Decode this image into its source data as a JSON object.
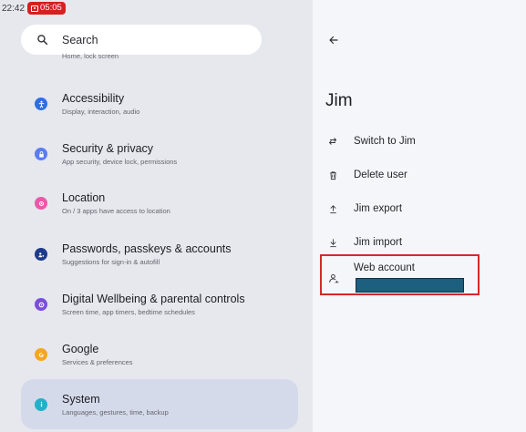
{
  "status_bar": {
    "time": "22:42",
    "recording_time": "05:05"
  },
  "search": {
    "placeholder": "Search",
    "icon": "search-icon"
  },
  "clipped_item_subtitle": "Home, lock screen",
  "settings_items": [
    {
      "title": "Accessibility",
      "subtitle": "Display, interaction, audio",
      "icon": "accessibility-icon",
      "color": "#2f6fe0"
    },
    {
      "title": "Security & privacy",
      "subtitle": "App security, device lock, permissions",
      "icon": "lock-icon",
      "color": "#5b7df0"
    },
    {
      "title": "Location",
      "subtitle": "On / 3 apps have access to location",
      "icon": "location-pin-icon",
      "color": "#e85aa8"
    },
    {
      "title": "Passwords, passkeys & accounts",
      "subtitle": "Suggestions for sign-in & autofill",
      "icon": "accounts-icon",
      "color": "#1e3a8a"
    },
    {
      "title": "Digital Wellbeing & parental controls",
      "subtitle": "Screen time, app timers, bedtime schedules",
      "icon": "wellbeing-icon",
      "color": "#7a4fd8"
    },
    {
      "title": "Google",
      "subtitle": "Services & preferences",
      "icon": "google-icon",
      "color": "#f5a623"
    },
    {
      "title": "System",
      "subtitle": "Languages, gestures, time, backup",
      "icon": "info-icon",
      "color": "#23b0c9"
    }
  ],
  "user_panel": {
    "back_icon": "back-arrow-icon",
    "name": "Jim",
    "actions": [
      {
        "label": "Switch to Jim",
        "icon": "switch-user-icon"
      },
      {
        "label": "Delete user",
        "icon": "trash-icon"
      },
      {
        "label": "Jim export",
        "icon": "upload-icon"
      },
      {
        "label": "Jim import",
        "icon": "download-icon"
      }
    ],
    "web_account": {
      "label": "Web account",
      "icon": "web-account-icon"
    }
  },
  "colors": {
    "highlight_border": "#d9262c",
    "redaction": "#1c5f7e",
    "selected_item_bg": "#d5daea"
  }
}
